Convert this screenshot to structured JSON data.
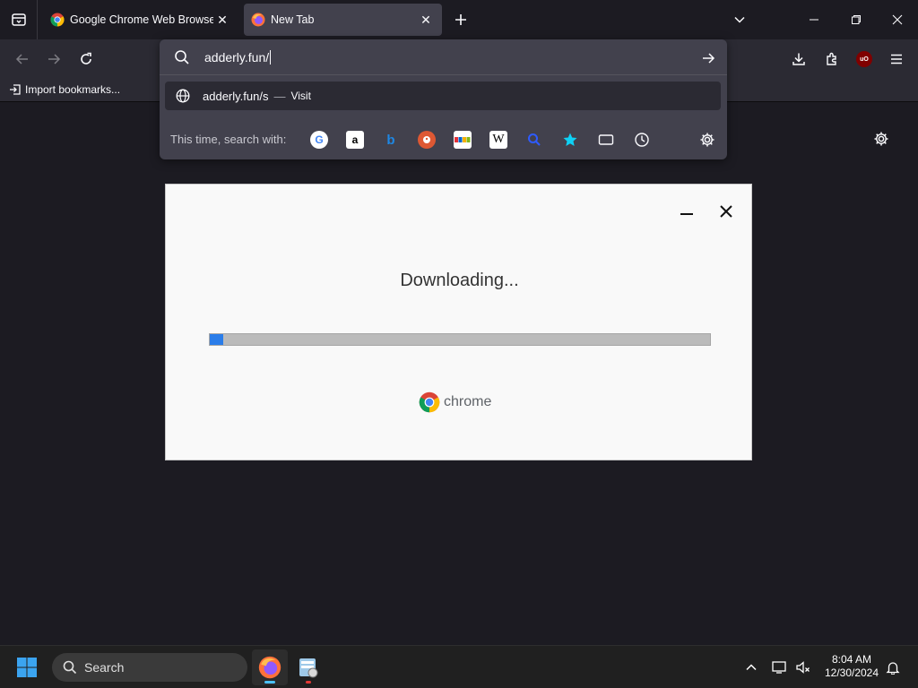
{
  "browser": {
    "tabs": [
      {
        "title": "Google Chrome Web Browser",
        "icon": "chrome-favicon",
        "active": false
      },
      {
        "title": "New Tab",
        "icon": "firefox-favicon",
        "active": true
      }
    ]
  },
  "urlbar": {
    "value": "adderly.fun/",
    "suggestion": {
      "url": "adderly.fun/s",
      "separator": "—",
      "action": "Visit"
    },
    "search_with_label": "This time, search with:",
    "engines": [
      "google",
      "amazon",
      "bing",
      "duckduckgo",
      "ebay",
      "wikipedia",
      "search",
      "bookmarks",
      "tabs",
      "history"
    ]
  },
  "bookmarks": {
    "import_label": "Import bookmarks..."
  },
  "popup": {
    "title": "Downloading...",
    "progress": 0.027,
    "brand": "chrome",
    "accent": "#2b7de9"
  },
  "taskbar": {
    "search_label": "Search",
    "time": "8:04 AM",
    "date": "12/30/2024"
  }
}
